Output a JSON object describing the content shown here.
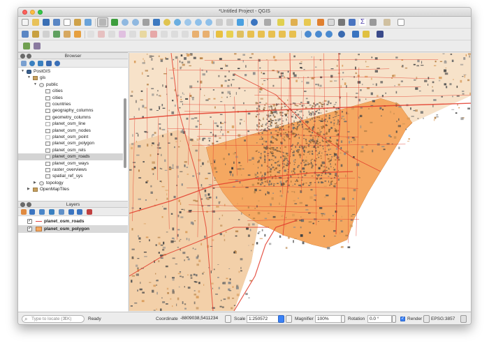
{
  "window": {
    "title": "*Untitled Project - QGIS"
  },
  "browser": {
    "header": "Browser",
    "tree": [
      {
        "label": "PostGIS",
        "level": 0,
        "expanded": true,
        "icon": "elephant-icon"
      },
      {
        "label": "gis",
        "level": 1,
        "expanded": true,
        "icon": "connection-icon"
      },
      {
        "label": "public",
        "level": 2,
        "expanded": true,
        "icon": "schema-icon"
      },
      {
        "label": "cities",
        "level": 3,
        "icon": "polygon-table-icon"
      },
      {
        "label": "cities",
        "level": 3,
        "icon": "polygon-table-icon"
      },
      {
        "label": "countries",
        "level": 3,
        "icon": "polygon-table-icon"
      },
      {
        "label": "geography_columns",
        "level": 3,
        "icon": "table-icon"
      },
      {
        "label": "geometry_columns",
        "level": 3,
        "icon": "table-icon"
      },
      {
        "label": "planet_osm_line",
        "level": 3,
        "icon": "line-table-icon"
      },
      {
        "label": "planet_osm_nodes",
        "level": 3,
        "icon": "table-icon"
      },
      {
        "label": "planet_osm_point",
        "level": 3,
        "icon": "point-table-icon"
      },
      {
        "label": "planet_osm_polygon",
        "level": 3,
        "icon": "polygon-table-icon"
      },
      {
        "label": "planet_osm_rels",
        "level": 3,
        "icon": "table-icon"
      },
      {
        "label": "planet_osm_roads",
        "level": 3,
        "icon": "line-table-icon",
        "selected": true
      },
      {
        "label": "planet_osm_ways",
        "level": 3,
        "icon": "table-icon"
      },
      {
        "label": "raster_overviews",
        "level": 3,
        "icon": "table-icon"
      },
      {
        "label": "spatial_ref_sys",
        "level": 3,
        "icon": "table-icon"
      },
      {
        "label": "topology",
        "level": 2,
        "expanded": false,
        "icon": "schema-icon"
      },
      {
        "label": "OpenMapTiles",
        "level": 1,
        "expanded": false,
        "icon": "connection-icon"
      }
    ]
  },
  "layers": {
    "header": "Layers",
    "items": [
      {
        "label": "planet_osm_roads",
        "checked": true,
        "style": "line"
      },
      {
        "label": "planet_osm_polygon",
        "checked": true,
        "style": "fill",
        "selected": true
      }
    ]
  },
  "status": {
    "search_placeholder": "Type to locate (⌘K)",
    "ready": "Ready",
    "coordinate_label": "Coordinate",
    "coordinate_value": "-8809038,5411234",
    "scale_label": "Scale",
    "scale_value": "1:250572",
    "magnifier_label": "Magnifier",
    "magnifier_value": "100%",
    "rotation_label": "Rotation",
    "rotation_value": "0.0 °",
    "render_label": "Render",
    "render_checked": true,
    "crs": "EPSG:3857"
  },
  "colors": {
    "polygon_fill": "#f5a861",
    "road": "#e23a2a",
    "building": "#555555"
  }
}
